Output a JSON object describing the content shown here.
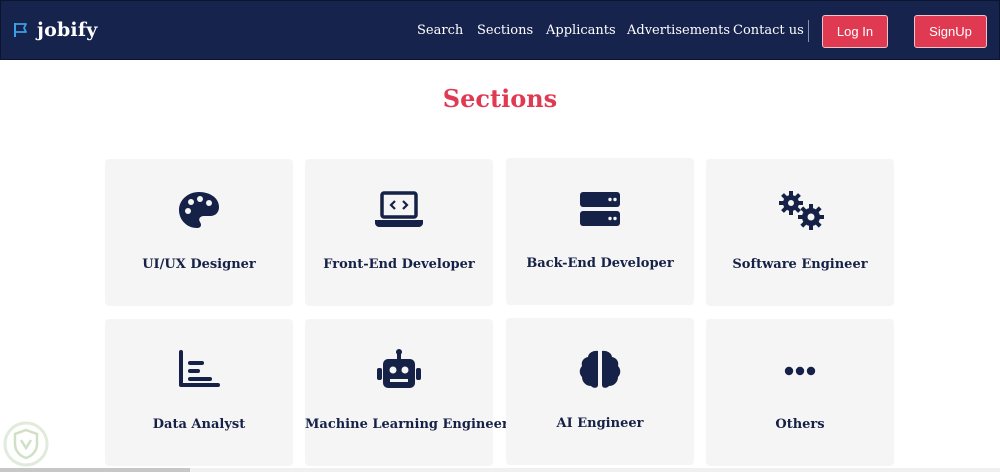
{
  "brand": {
    "name": "jobify",
    "icon": "flag-icon"
  },
  "nav": {
    "links": [
      "Search",
      "Sections",
      "Applicants",
      "Advertisements",
      "Contact us"
    ],
    "login_label": "Log In",
    "signup_label": "SignUp"
  },
  "page": {
    "title": "Sections"
  },
  "sections": [
    {
      "label": "UI/UX Designer",
      "icon": "palette-icon"
    },
    {
      "label": "Front-End Developer",
      "icon": "laptop-code-icon"
    },
    {
      "label": "Back-End Developer",
      "icon": "server-icon"
    },
    {
      "label": "Software Engineer",
      "icon": "gears-icon"
    },
    {
      "label": "Data Analyst",
      "icon": "chart-icon"
    },
    {
      "label": "Machine Learning Engineer",
      "icon": "robot-icon"
    },
    {
      "label": "AI Engineer",
      "icon": "brain-icon"
    },
    {
      "label": "Others",
      "icon": "ellipsis-icon"
    }
  ],
  "colors": {
    "navbar": "#16234d",
    "accent": "#e03a52",
    "card": "#f5f5f5",
    "icon": "#152146"
  }
}
